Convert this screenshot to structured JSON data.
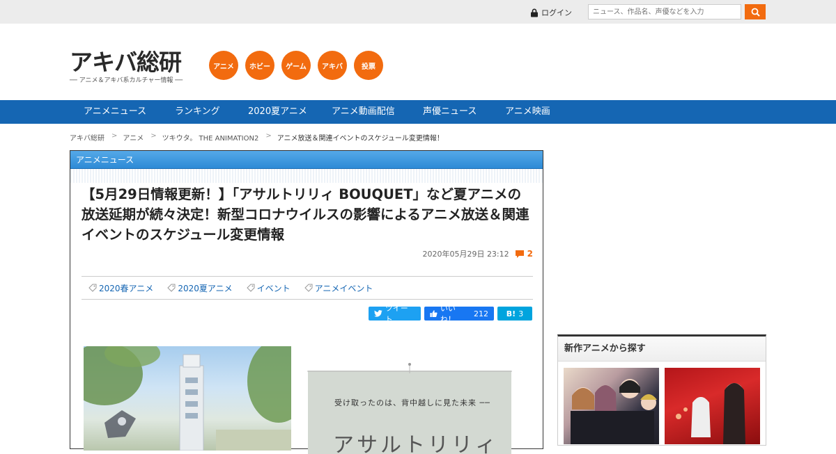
{
  "topbar": {
    "login_label": "ログイン",
    "search_placeholder": "ニュース、作品名、声優などを入力"
  },
  "header": {
    "logo_text": "アキバ総研",
    "logo_sub": "── アニメ＆アキバ系カルチャー情報 ──",
    "categories": [
      "アニメ",
      "ホビー",
      "ゲーム",
      "アキバ",
      "投票"
    ]
  },
  "nav": {
    "items": [
      "アニメニュース",
      "ランキング",
      "2020夏アニメ",
      "アニメ動画配信",
      "声優ニュース",
      "アニメ映画"
    ]
  },
  "breadcrumb": [
    "アキバ総研",
    "アニメ",
    "ツキウタ。 THE ANIMATION2",
    "アニメ放送＆関連イベントのスケジュール変更情報！"
  ],
  "article": {
    "category": "アニメニュース",
    "title": "【5月29日情報更新！】「アサルトリリィ BOUQUET」など夏アニメの放送延期が続々決定！新型コロナウイルスの影響によるアニメ放送＆関連イベントのスケジュール変更情報",
    "date": "2020年05月29日 23:12",
    "comment_count": "2",
    "tags": [
      "2020春アニメ",
      "2020夏アニメ",
      "イベント",
      "アニメイベント"
    ],
    "share": {
      "tweet_label": "ツイート",
      "like_label": "いいね！",
      "like_count": "212",
      "hatena_label": "B!",
      "hatena_count": "3"
    },
    "image2_text": "受け取ったのは、背中越しに見た未来 ──",
    "image2_big": "アサルトリリィ"
  },
  "sidebar": {
    "heading": "新作アニメから探す"
  },
  "colors": {
    "accent": "#f26b0f",
    "nav": "#1566b3",
    "category_header": "#2d8ad6"
  }
}
